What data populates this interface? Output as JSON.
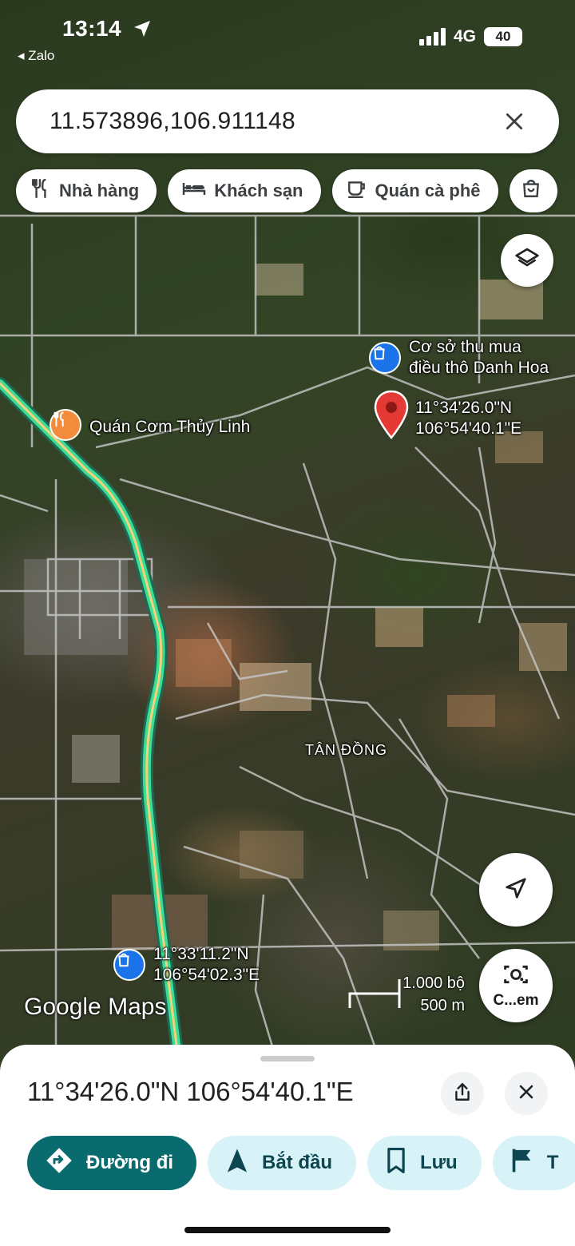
{
  "status_bar": {
    "time": "13:14",
    "back_app": "◂ Zalo",
    "network": "4G",
    "battery": "40"
  },
  "search": {
    "value": "11.573896,106.911148"
  },
  "chips": [
    {
      "label": "Nhà hàng",
      "icon": "restaurant-icon"
    },
    {
      "label": "Khách sạn",
      "icon": "hotel-icon"
    },
    {
      "label": "Quán cà phê",
      "icon": "coffee-icon"
    },
    {
      "label": "",
      "icon": "shopping-bag-icon"
    }
  ],
  "map": {
    "poi_shop": {
      "line1": "Cơ sở thu mua",
      "line2": "điều thô Danh Hoa"
    },
    "poi_restaurant": "Quán Cơm Thủy Linh",
    "pin": {
      "lat": "11°34'26.0\"N",
      "lng": "106°54'40.1\"E"
    },
    "poi_bottom": {
      "lat": "11°33'11.2\"N",
      "lng": "106°54'02.3\"E"
    },
    "area_label": "TÂN ĐỒNG",
    "scale_top": "1.000 bộ",
    "scale_bottom": "500 m",
    "brand_google": "Google",
    "brand_maps": "Maps",
    "lens_label": "C...em"
  },
  "sheet": {
    "title": "11°34'26.0\"N 106°54'40.1\"E",
    "actions": [
      {
        "label": "Đường đi",
        "icon": "directions-icon"
      },
      {
        "label": "Bắt đầu",
        "icon": "navigation-arrow-icon"
      },
      {
        "label": "Lưu",
        "icon": "bookmark-icon"
      },
      {
        "label": "T",
        "icon": "flag-icon"
      }
    ]
  },
  "colors": {
    "accent": "#0a6b6f",
    "accent_light": "#d7f3f7",
    "pin": "#e53935",
    "highway": "#3ddc97",
    "poi_blue": "#1a73e8",
    "poi_orange": "#f28b3c"
  }
}
